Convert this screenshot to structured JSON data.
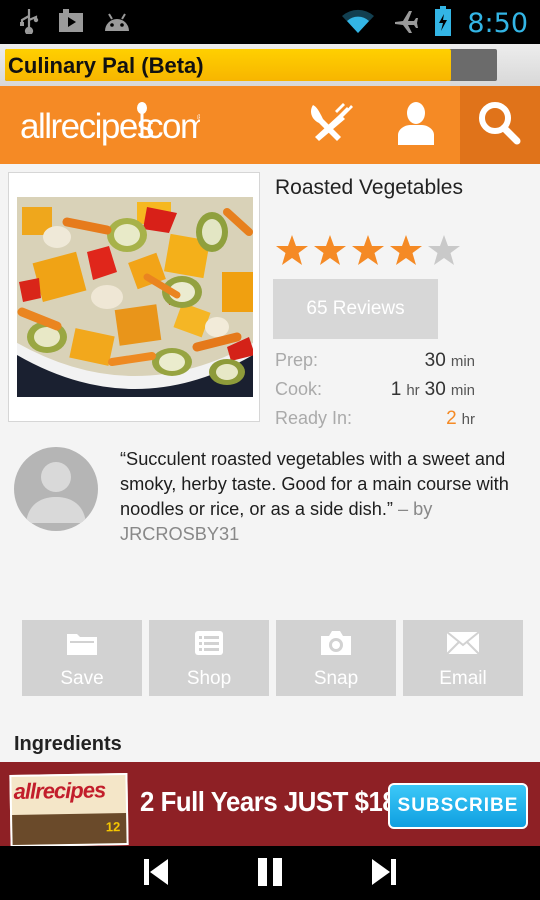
{
  "status_bar": {
    "time": "8:50",
    "icons": [
      "usb-icon",
      "youtube-icon",
      "android-icon",
      "wifi-icon",
      "airplane-icon",
      "battery-icon"
    ],
    "time_color": "#33b5e5"
  },
  "app_bar": {
    "title": "Culinary Pal (Beta)",
    "progress_fraction": 0.906,
    "accent": "#ffc400"
  },
  "brand_bar": {
    "logo": "allrecipes.com",
    "color": "#f58a25",
    "nav": [
      "recipes-icon",
      "profile-icon",
      "search-icon"
    ]
  },
  "recipe": {
    "title": "Roasted Vegetables",
    "rating": 4,
    "rating_max": 5,
    "reviews_label": "65 Reviews",
    "times": {
      "prep": {
        "label": "Prep:",
        "parts": [
          {
            "num": "30",
            "unit": "min"
          }
        ]
      },
      "cook": {
        "label": "Cook:",
        "parts": [
          {
            "num": "1",
            "unit": "hr"
          },
          {
            "num": "30",
            "unit": "min"
          }
        ]
      },
      "ready": {
        "label": "Ready In:",
        "parts": [
          {
            "num": "2",
            "unit": "hr"
          }
        ]
      }
    }
  },
  "review": {
    "quote": "“Succulent roasted vegetables with a sweet and smoky, herby taste. Good for a main course with noodles or rice, or as a side dish.”",
    "author": " – by JRCROSBY31"
  },
  "actions": {
    "save": "Save",
    "shop": "Shop",
    "snap": "Snap",
    "email": "Email"
  },
  "ingredients_heading": "Ingredients",
  "ad": {
    "magazine_title": "allrecipes",
    "magazine_number": "12",
    "text": "2 Full Years JUST $18!",
    "button": "SUBSCRIBE"
  },
  "media_controls": [
    "previous-icon",
    "pause-icon",
    "next-icon"
  ]
}
